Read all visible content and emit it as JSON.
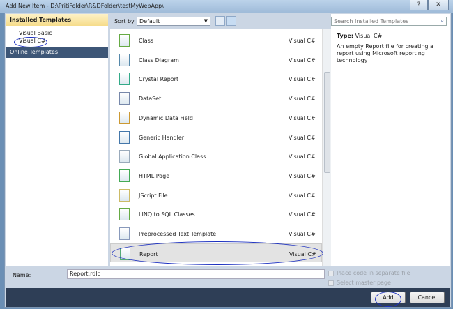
{
  "window": {
    "title": "Add New Item - D:\\PritiFolder\\R&DFolder\\testMyWebApp\\",
    "help": "?",
    "close": "✕"
  },
  "sidebar": {
    "header": "Installed Templates",
    "items": [
      {
        "label": "Visual Basic"
      },
      {
        "label": "Visual C#"
      }
    ],
    "online": "Online Templates"
  },
  "toolbar": {
    "sort_label": "Sort by:",
    "sort_value": "Default"
  },
  "templates": [
    {
      "name": "Class",
      "lang": "Visual C#"
    },
    {
      "name": "Class Diagram",
      "lang": "Visual C#"
    },
    {
      "name": "Crystal Report",
      "lang": "Visual C#"
    },
    {
      "name": "DataSet",
      "lang": "Visual C#"
    },
    {
      "name": "Dynamic Data Field",
      "lang": "Visual C#"
    },
    {
      "name": "Generic Handler",
      "lang": "Visual C#"
    },
    {
      "name": "Global Application Class",
      "lang": "Visual C#"
    },
    {
      "name": "HTML Page",
      "lang": "Visual C#"
    },
    {
      "name": "JScript File",
      "lang": "Visual C#"
    },
    {
      "name": "LINQ to SQL Classes",
      "lang": "Visual C#"
    },
    {
      "name": "Preprocessed Text Template",
      "lang": "Visual C#"
    },
    {
      "name": "Report",
      "lang": "Visual C#",
      "selected": true
    }
  ],
  "details": {
    "search_placeholder": "Search Installed Templates",
    "type_label": "Type:",
    "type_value": "Visual C#",
    "description": "An empty Report file for creating a report using Microsoft reporting technology"
  },
  "form": {
    "name_label": "Name:",
    "name_value": "Report.rdlc",
    "place_code": "Place code in separate file",
    "master_page": "Select master page"
  },
  "buttons": {
    "add": "Add",
    "cancel": "Cancel"
  },
  "colors": {
    "annotation": "#1b2fbf",
    "selection_bg": "#3d5677",
    "bottom_bar": "#2e3e56"
  }
}
